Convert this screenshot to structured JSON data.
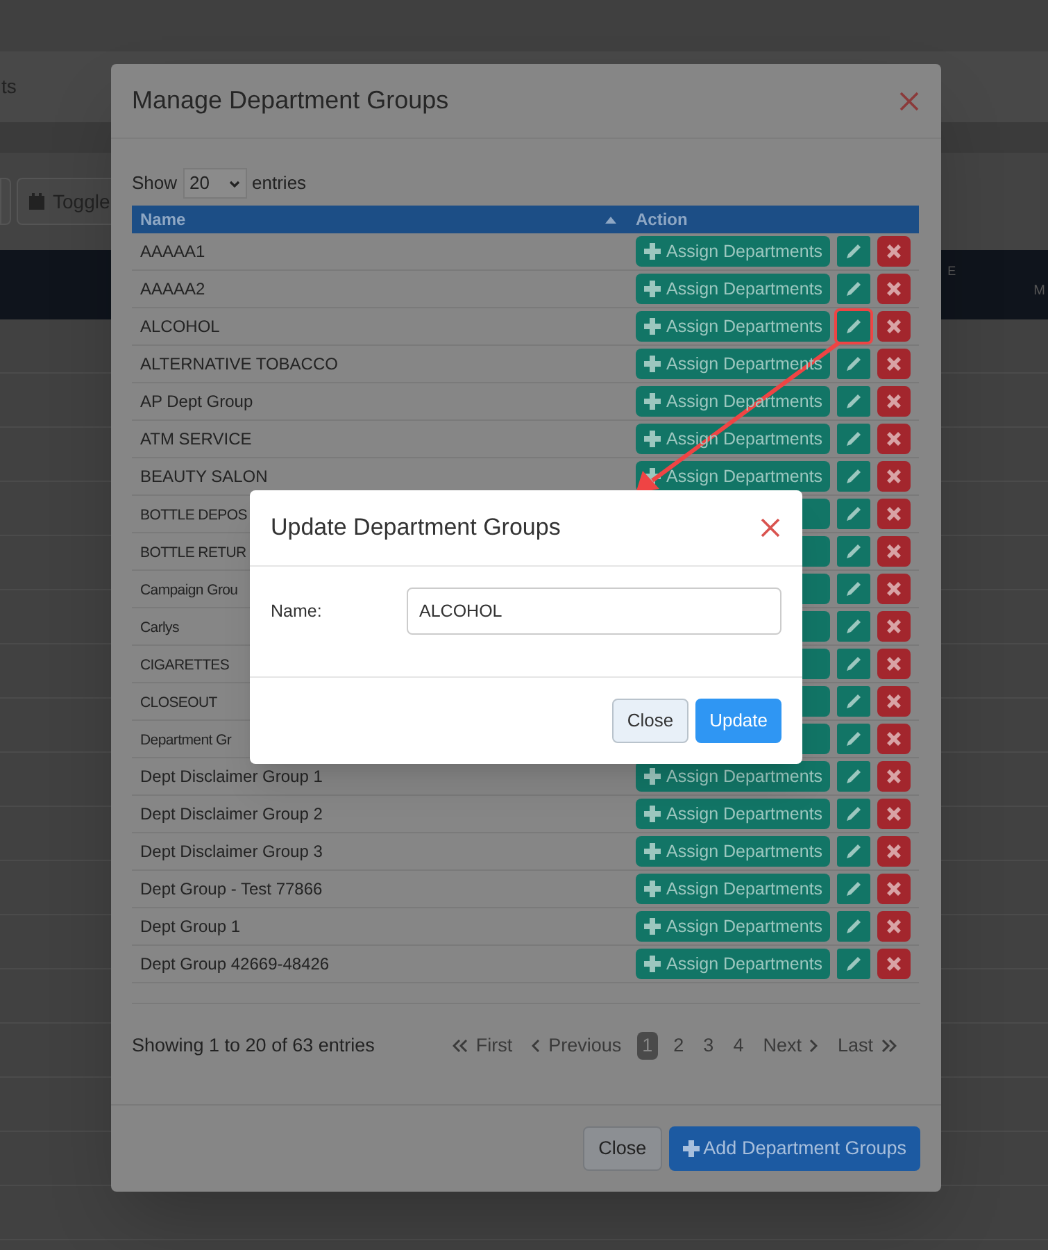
{
  "background_page": {
    "nav_text": "ts",
    "toggle_button": "Toggle",
    "header_cells": [
      "E",
      "M"
    ]
  },
  "manage_dialog": {
    "title": "Manage Department Groups",
    "length_menu": {
      "before": "Show",
      "value": "20",
      "after": "entries"
    },
    "columns": [
      {
        "label": "Name",
        "sorted": true
      },
      {
        "label": "Action",
        "sorted": false
      }
    ],
    "rows": [
      {
        "name": "AAAAA1",
        "assign": "Assign Departments",
        "highlighted": false
      },
      {
        "name": "AAAAA2",
        "assign": "Assign Departments",
        "highlighted": false
      },
      {
        "name": "ALCOHOL",
        "assign": "Assign Departments",
        "highlighted": true
      },
      {
        "name": "ALTERNATIVE TOBACCO",
        "assign": "Assign Departments",
        "highlighted": false
      },
      {
        "name": "AP Dept Group",
        "assign": "Assign Departments",
        "highlighted": false
      },
      {
        "name": "ATM SERVICE",
        "assign": "Assign Departments",
        "highlighted": false
      },
      {
        "name": "BEAUTY SALON",
        "assign": "Assign Departments",
        "highlighted": false
      },
      {
        "name": "BOTTLE DEPOS",
        "highlighted": false
      },
      {
        "name": "BOTTLE RETUR",
        "highlighted": false
      },
      {
        "name": "Campaign Grou",
        "highlighted": false
      },
      {
        "name": "Carlys",
        "highlighted": false
      },
      {
        "name": "CIGARETTES",
        "highlighted": false
      },
      {
        "name": "CLOSEOUT",
        "highlighted": false
      },
      {
        "name": "Department Gr",
        "highlighted": false
      },
      {
        "name": "Dept Disclaimer Group 1",
        "assign": "Assign Departments",
        "highlighted": false
      },
      {
        "name": "Dept Disclaimer Group 2",
        "assign": "Assign Departments",
        "highlighted": false
      },
      {
        "name": "Dept Disclaimer Group 3",
        "assign": "Assign Departments",
        "highlighted": false
      },
      {
        "name": "Dept Group - Test 77866",
        "assign": "Assign Departments",
        "highlighted": false
      },
      {
        "name": "Dept Group 1",
        "assign": "Assign Departments",
        "highlighted": false
      },
      {
        "name": "Dept Group 42669-48426",
        "assign": "Assign Departments",
        "highlighted": false
      }
    ],
    "info": "Showing 1 to 20 of 63 entries",
    "pagination": [
      {
        "kind": "first",
        "label": "First",
        "selected": false
      },
      {
        "kind": "prev",
        "label": "Previous",
        "selected": false
      },
      {
        "kind": "page",
        "label": "1",
        "selected": true
      },
      {
        "kind": "page",
        "label": "2",
        "selected": false
      },
      {
        "kind": "page",
        "label": "3",
        "selected": false
      },
      {
        "kind": "page",
        "label": "4",
        "selected": false
      },
      {
        "kind": "next",
        "label": "Next",
        "selected": false
      },
      {
        "kind": "last",
        "label": "Last",
        "selected": false
      }
    ],
    "buttons": [
      {
        "kind": "close",
        "label": "Close"
      },
      {
        "kind": "add",
        "label": "Add Department Groups"
      }
    ]
  },
  "update_dialog": {
    "title": "Update Department Groups",
    "field_label": "Name:",
    "field_value": "ALCOHOL",
    "buttons": [
      {
        "kind": "close",
        "label": "Close"
      },
      {
        "kind": "primary",
        "label": "Update"
      }
    ]
  }
}
